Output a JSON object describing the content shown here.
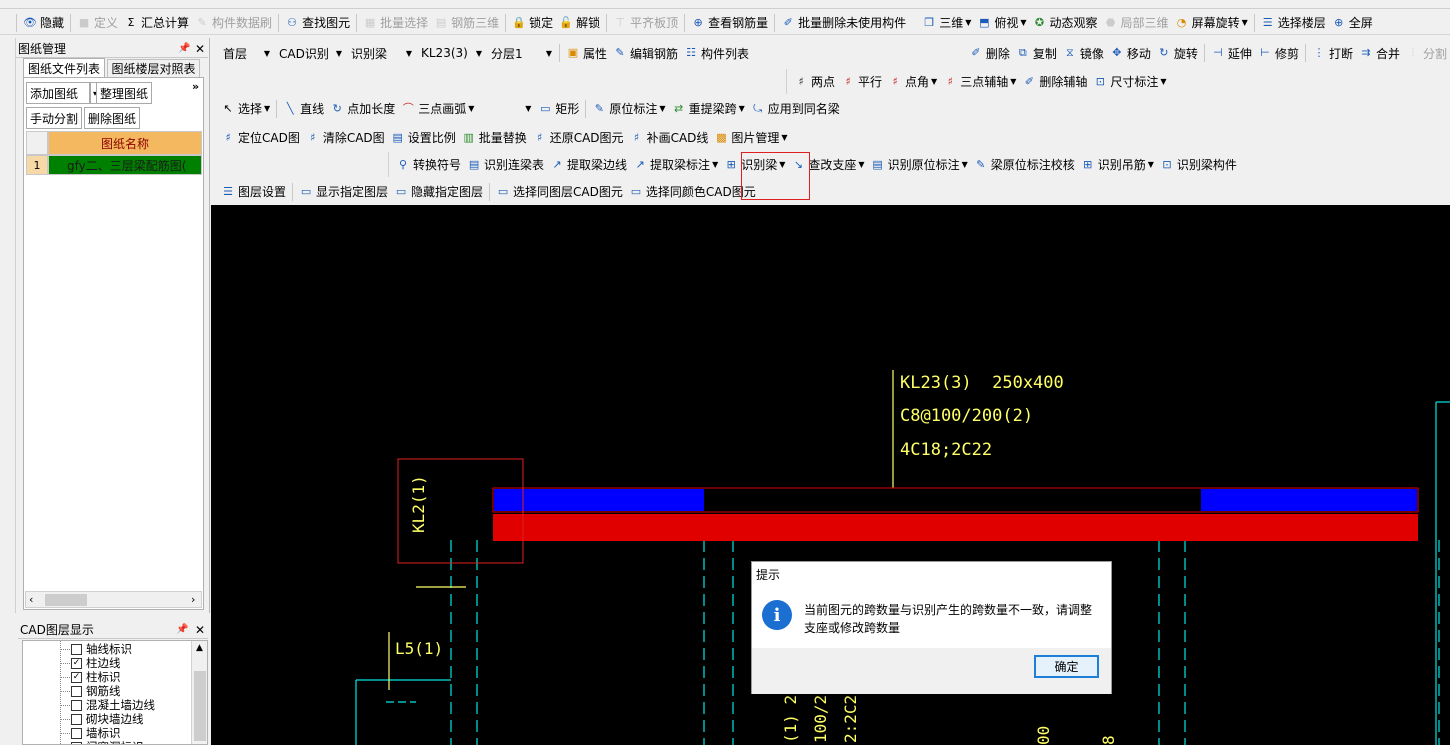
{
  "toolbar1": {
    "items": [
      {
        "label": "隐藏",
        "icon": "eye-icon",
        "disabled": false
      },
      {
        "label": "定义",
        "icon": "define-icon",
        "disabled": true
      },
      {
        "label": "汇总计算",
        "icon": "sigma-icon",
        "disabled": false
      },
      {
        "label": "构件数据刷",
        "icon": "brush-icon",
        "disabled": true
      },
      {
        "label": "查找图元",
        "icon": "binoculars-icon",
        "disabled": false
      },
      {
        "label": "批量选择",
        "icon": "batch-select-icon",
        "disabled": true
      },
      {
        "label": "钢筋三维",
        "icon": "rebar-3d-icon",
        "disabled": true
      },
      {
        "label": "锁定",
        "icon": "lock-icon",
        "disabled": false
      },
      {
        "label": "解锁",
        "icon": "unlock-icon",
        "disabled": false
      },
      {
        "label": "平齐板顶",
        "icon": "align-top-icon",
        "disabled": true
      },
      {
        "label": "查看钢筋量",
        "icon": "view-rebar-icon",
        "disabled": false
      },
      {
        "label": "批量删除未使用构件",
        "icon": "batch-delete-icon",
        "disabled": false
      }
    ],
    "right_items": [
      {
        "label": "三维",
        "icon": "cube-icon",
        "dropdown": true,
        "disabled": false
      },
      {
        "label": "俯视",
        "icon": "top-view-icon",
        "dropdown": true,
        "disabled": false
      },
      {
        "label": "动态观察",
        "icon": "orbit-icon",
        "dropdown": false,
        "disabled": false
      },
      {
        "label": "局部三维",
        "icon": "local-3d-icon",
        "dropdown": false,
        "disabled": true
      },
      {
        "label": "屏幕旋转",
        "icon": "screen-rotate-icon",
        "dropdown": true,
        "disabled": false
      },
      {
        "label": "选择楼层",
        "icon": "select-floor-icon",
        "dropdown": false,
        "disabled": false
      },
      {
        "label": "全屏",
        "icon": "zoom-full-icon",
        "dropdown": false,
        "disabled": false
      }
    ]
  },
  "combos": {
    "floor": "首层",
    "cad_recognize": "CAD识别",
    "recognize_beam": "识别梁",
    "component": "KL23(3)",
    "layer": "分层1"
  },
  "toolbar2": {
    "items": [
      {
        "label": "属性",
        "icon": "property-icon"
      },
      {
        "label": "编辑钢筋",
        "icon": "edit-rebar-icon"
      },
      {
        "label": "构件列表",
        "icon": "component-list-icon"
      }
    ],
    "right_items": [
      {
        "label": "删除",
        "icon": "delete-icon",
        "disabled": false
      },
      {
        "label": "复制",
        "icon": "copy-icon",
        "disabled": false
      },
      {
        "label": "镜像",
        "icon": "mirror-icon",
        "disabled": false
      },
      {
        "label": "移动",
        "icon": "move-icon",
        "disabled": false
      },
      {
        "label": "旋转",
        "icon": "rotate-icon",
        "disabled": false
      },
      {
        "label": "延伸",
        "icon": "extend-icon",
        "disabled": false
      },
      {
        "label": "修剪",
        "icon": "trim-icon",
        "disabled": false
      },
      {
        "label": "打断",
        "icon": "break-icon",
        "disabled": false
      },
      {
        "label": "合并",
        "icon": "merge-icon",
        "disabled": false
      },
      {
        "label": "分割",
        "icon": "split-icon",
        "disabled": true
      }
    ]
  },
  "toolbar3": {
    "items": [
      {
        "label": "两点",
        "icon": "two-point-axis-icon",
        "dropdown": false
      },
      {
        "label": "平行",
        "icon": "parallel-axis-icon",
        "dropdown": false
      },
      {
        "label": "点角",
        "icon": "point-angle-icon",
        "dropdown": true
      },
      {
        "label": "三点辅轴",
        "icon": "three-point-axis-icon",
        "dropdown": true
      },
      {
        "label": "删除辅轴",
        "icon": "delete-axis-icon",
        "dropdown": false
      },
      {
        "label": "尺寸标注",
        "icon": "dimension-icon",
        "dropdown": true
      }
    ]
  },
  "toolbar4": {
    "select_label": "选择",
    "line_label": "直线",
    "point_length_label": "点加长度",
    "arc_label": "三点画弧",
    "rect_label": "矩形",
    "origin_label": "原位标注",
    "redo_span_label": "重提梁跨",
    "apply_same_label": "应用到同名梁"
  },
  "toolbar5": {
    "items": [
      {
        "label": "定位CAD图",
        "icon": "locate-cad-icon",
        "dropdown": false
      },
      {
        "label": "清除CAD图",
        "icon": "clear-cad-icon",
        "dropdown": false
      },
      {
        "label": "设置比例",
        "icon": "scale-icon",
        "dropdown": false
      },
      {
        "label": "批量替换",
        "icon": "batch-replace-icon",
        "dropdown": false
      },
      {
        "label": "还原CAD图元",
        "icon": "restore-cad-icon",
        "dropdown": false
      },
      {
        "label": "补画CAD线",
        "icon": "draw-cad-line-icon",
        "dropdown": false
      },
      {
        "label": "图片管理",
        "icon": "image-manage-icon",
        "dropdown": true
      }
    ]
  },
  "toolbar6": {
    "items": [
      {
        "label": "转换符号",
        "icon": "convert-symbol-icon",
        "dropdown": false
      },
      {
        "label": "识别连梁表",
        "icon": "beam-table-icon",
        "dropdown": false
      },
      {
        "label": "提取梁边线",
        "icon": "extract-beam-edge-icon",
        "dropdown": false
      },
      {
        "label": "提取梁标注",
        "icon": "extract-beam-label-icon",
        "dropdown": true
      },
      {
        "label": "识别梁",
        "icon": "recognize-beam-icon",
        "dropdown": true
      },
      {
        "label": "查改支座",
        "icon": "support-icon",
        "dropdown": true
      },
      {
        "label": "识别原位标注",
        "icon": "recognize-origin-icon",
        "dropdown": true
      },
      {
        "label": "梁原位标注校核",
        "icon": "check-origin-icon",
        "dropdown": false
      },
      {
        "label": "识别吊筋",
        "icon": "hanger-rebar-icon",
        "dropdown": true
      },
      {
        "label": "识别梁构件",
        "icon": "recognize-beam-component-icon",
        "dropdown": false
      }
    ]
  },
  "toolbar7": {
    "items": [
      {
        "label": "图层设置",
        "icon": "layer-settings-icon"
      },
      {
        "label": "显示指定图层",
        "icon": "show-layer-icon"
      },
      {
        "label": "隐藏指定图层",
        "icon": "hide-layer-icon"
      },
      {
        "label": "选择同图层CAD图元",
        "icon": "select-same-layer-icon"
      },
      {
        "label": "选择同颜色CAD图元",
        "icon": "select-same-color-icon"
      }
    ]
  },
  "drawing_panel": {
    "title": "图纸管理",
    "tabs": [
      "图纸文件列表",
      "图纸楼层对照表"
    ],
    "buttons": [
      "添加图纸",
      "整理图纸",
      "手动分割",
      "删除图纸"
    ],
    "header": "图纸名称",
    "rows": [
      {
        "index": "1",
        "name": "gfy二、三层梁配筋图("
      }
    ]
  },
  "layer_panel": {
    "title": "CAD图层显示",
    "items": [
      {
        "label": "轴线标识",
        "checked": false
      },
      {
        "label": "柱边线",
        "checked": true
      },
      {
        "label": "柱标识",
        "checked": true
      },
      {
        "label": "钢筋线",
        "checked": false
      },
      {
        "label": "混凝土墙边线",
        "checked": false
      },
      {
        "label": "砌块墙边线",
        "checked": false
      },
      {
        "label": "墙标识",
        "checked": false
      },
      {
        "label": "门窗洞标识",
        "checked": false
      }
    ]
  },
  "canvas": {
    "beam_name": "KL23(3)  250x400",
    "beam_stirrup": "C8@100/200(2)",
    "beam_rebar": "4C18;2C22",
    "kl2": "KL2(1)",
    "l5": "L5(1)",
    "vert_1": "(1) 2",
    "vert_2": "100/2",
    "vert_3": "2:2C2",
    "vert_4": "00",
    "vert_5": "8"
  },
  "dialog": {
    "title": "提示",
    "message": "当前图元的跨数量与识别产生的跨数量不一致，请调整支座或修改跨数量",
    "ok": "确定"
  },
  "colors": {
    "canvas_bg": "#000000",
    "beam_blue": "#0000ff",
    "beam_red": "#e00000",
    "cad_yellow": "#ffff66",
    "cad_cyan": "#00e5e5",
    "selected_row": "#008000"
  }
}
